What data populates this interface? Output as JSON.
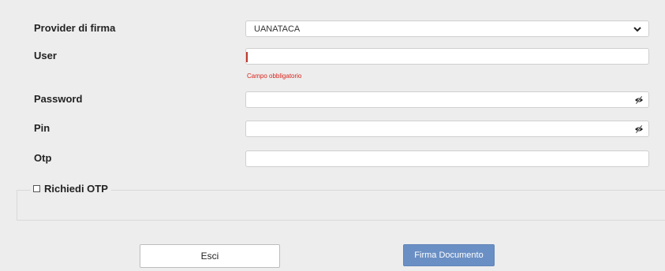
{
  "form": {
    "provider": {
      "label": "Provider di firma",
      "selected": "UANATACA"
    },
    "user": {
      "label": "User",
      "value": "",
      "error": "Campo obbligatorio"
    },
    "password": {
      "label": "Password",
      "value": ""
    },
    "pin": {
      "label": "Pin",
      "value": ""
    },
    "otp": {
      "label": "Otp",
      "value": ""
    },
    "richiedi_otp": {
      "label": "Richiedi OTP",
      "checked": false
    }
  },
  "buttons": {
    "esci": "Esci",
    "firma": "Firma Documento"
  },
  "colors": {
    "background": "#ededed",
    "error": "#d9241c",
    "primary_button": "#6a8fc4"
  },
  "icons": {
    "select": "chevron-down-icon",
    "password_toggle": "eye-slash-icon",
    "pin_toggle": "eye-slash-icon"
  }
}
